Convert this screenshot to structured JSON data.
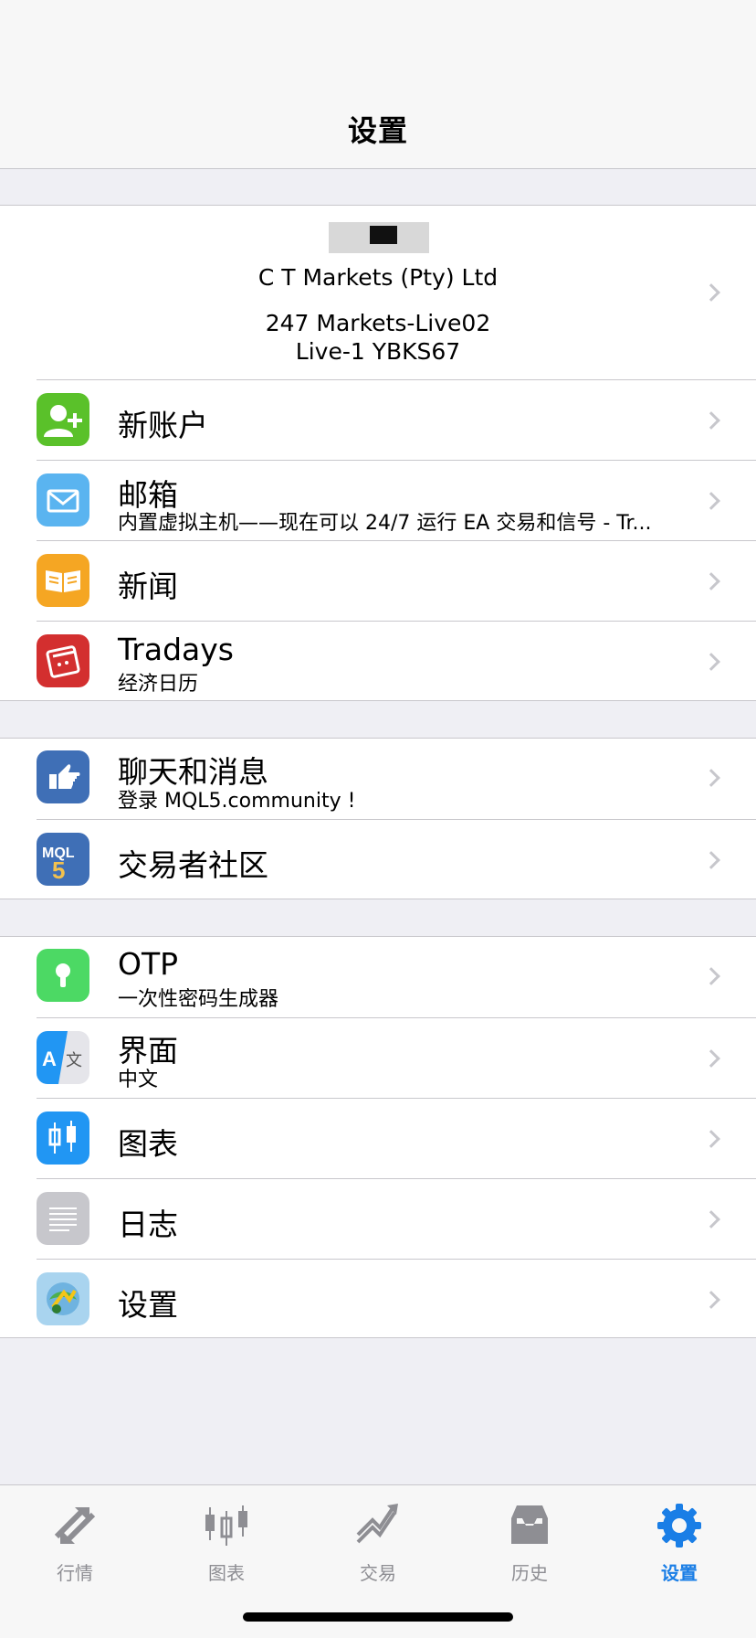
{
  "header": {
    "title": "设置"
  },
  "account": {
    "name": "",
    "broker": "C T Markets (Pty) Ltd",
    "server": "247 Markets-Live02",
    "login": "Live-1 YBKS67"
  },
  "group1": [
    {
      "label": "新账户",
      "sub": "",
      "icon": "add-user-icon"
    },
    {
      "label": "邮箱",
      "sub": "内置虚拟主机——现在可以 24/7 运行 EA 交易和信号 - Tr...",
      "icon": "mail-icon"
    },
    {
      "label": "新闻",
      "sub": "",
      "icon": "book-icon"
    },
    {
      "label": "Tradays",
      "sub": "经济日历",
      "icon": "calendar-icon"
    }
  ],
  "group2": [
    {
      "label": "聊天和消息",
      "sub": "登录 MQL5.community !",
      "icon": "thumbs-up-icon"
    },
    {
      "label": "交易者社区",
      "sub": "",
      "icon": "mql5-icon"
    }
  ],
  "group3": [
    {
      "label": "OTP",
      "sub": "一次性密码生成器",
      "icon": "keyhole-icon"
    },
    {
      "label": "界面",
      "sub": "中文",
      "icon": "translate-icon"
    },
    {
      "label": "图表",
      "sub": "",
      "icon": "candlestick-icon"
    },
    {
      "label": "日志",
      "sub": "",
      "icon": "journal-icon"
    },
    {
      "label": "设置",
      "sub": "",
      "icon": "metatrader-icon"
    }
  ],
  "tabs": [
    {
      "label": "行情",
      "icon": "quotes-arrows-icon",
      "active": false
    },
    {
      "label": "图表",
      "icon": "chart-candles-icon",
      "active": false
    },
    {
      "label": "交易",
      "icon": "trade-trend-icon",
      "active": false
    },
    {
      "label": "历史",
      "icon": "history-inbox-icon",
      "active": false
    },
    {
      "label": "设置",
      "icon": "settings-gear-icon",
      "active": true
    }
  ],
  "colors": {
    "active_tab": "#1a7ee6",
    "inactive_tab": "#8e8e93",
    "background": "#efeff4"
  }
}
